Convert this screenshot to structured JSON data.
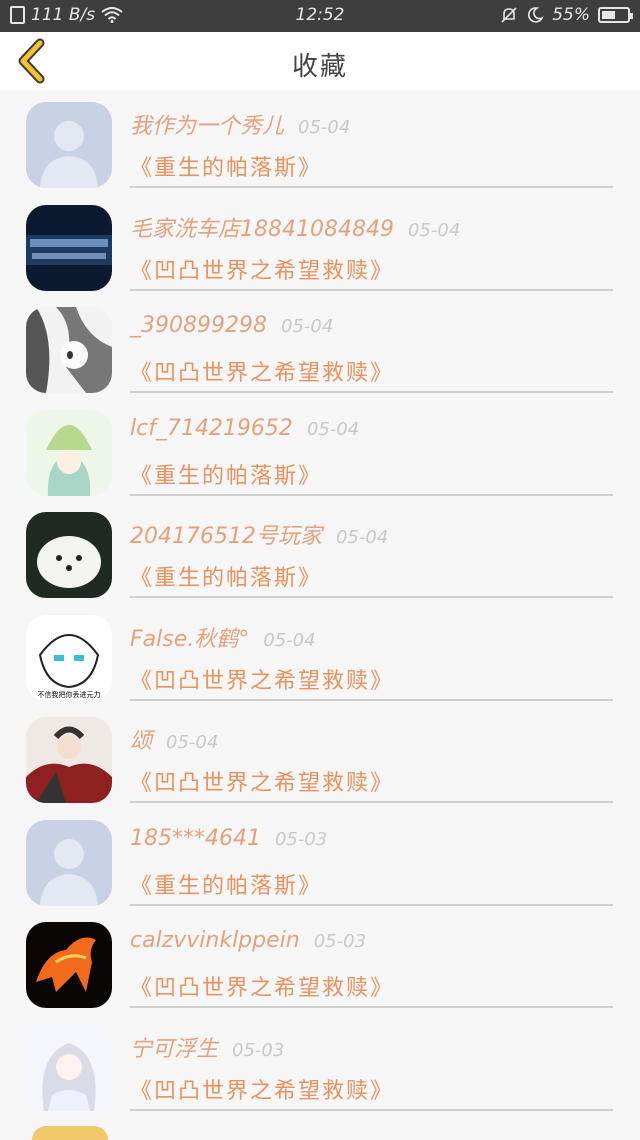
{
  "status_bar": {
    "speed": "111 B/s",
    "time": "12:52",
    "battery": "55%",
    "battery_level": 0.55
  },
  "header": {
    "title": "收藏",
    "back_icon": "chevron-left-icon",
    "accent": "#f2c230"
  },
  "colors": {
    "username": "#e3a27c",
    "book": "#e8925f",
    "date": "#c8c8c8"
  },
  "items": [
    {
      "username": "我作为一个秀儿",
      "date": "05-04",
      "book": "《重生的帕落斯》",
      "avatar": "default-avatar"
    },
    {
      "username": "毛家洗车店18841084849",
      "date": "05-04",
      "book": "《凹凸世界之希望救赎》",
      "avatar": "car-wash-avatar"
    },
    {
      "username": "_390899298",
      "date": "05-04",
      "book": "《凹凸世界之希望救赎》",
      "avatar": "anime-girl-avatar"
    },
    {
      "username": "lcf_714219652",
      "date": "05-04",
      "book": "《重生的帕落斯》",
      "avatar": "leaf-girl-avatar"
    },
    {
      "username": "204176512号玩家",
      "date": "05-04",
      "book": "《重生的帕落斯》",
      "avatar": "white-dog-avatar"
    },
    {
      "username": "False.秋鹤°",
      "date": "05-04",
      "book": "《凹凸世界之希望救赎》",
      "avatar": "sketch-avatar"
    },
    {
      "username": "颂",
      "date": "05-04",
      "book": "《凹凸世界之希望救赎》",
      "avatar": "warrior-avatar"
    },
    {
      "username": "185***4641",
      "date": "05-03",
      "book": "《重生的帕落斯》",
      "avatar": "default-avatar"
    },
    {
      "username": "calzvvinklppein",
      "date": "05-03",
      "book": "《凹凸世界之希望救赎》",
      "avatar": "fire-horse-avatar"
    },
    {
      "username": "宁可浮生",
      "date": "05-03",
      "book": "《凹凸世界之希望救赎》",
      "avatar": "white-hair-avatar"
    }
  ],
  "sketch_caption": "不信我把你丢进元力"
}
